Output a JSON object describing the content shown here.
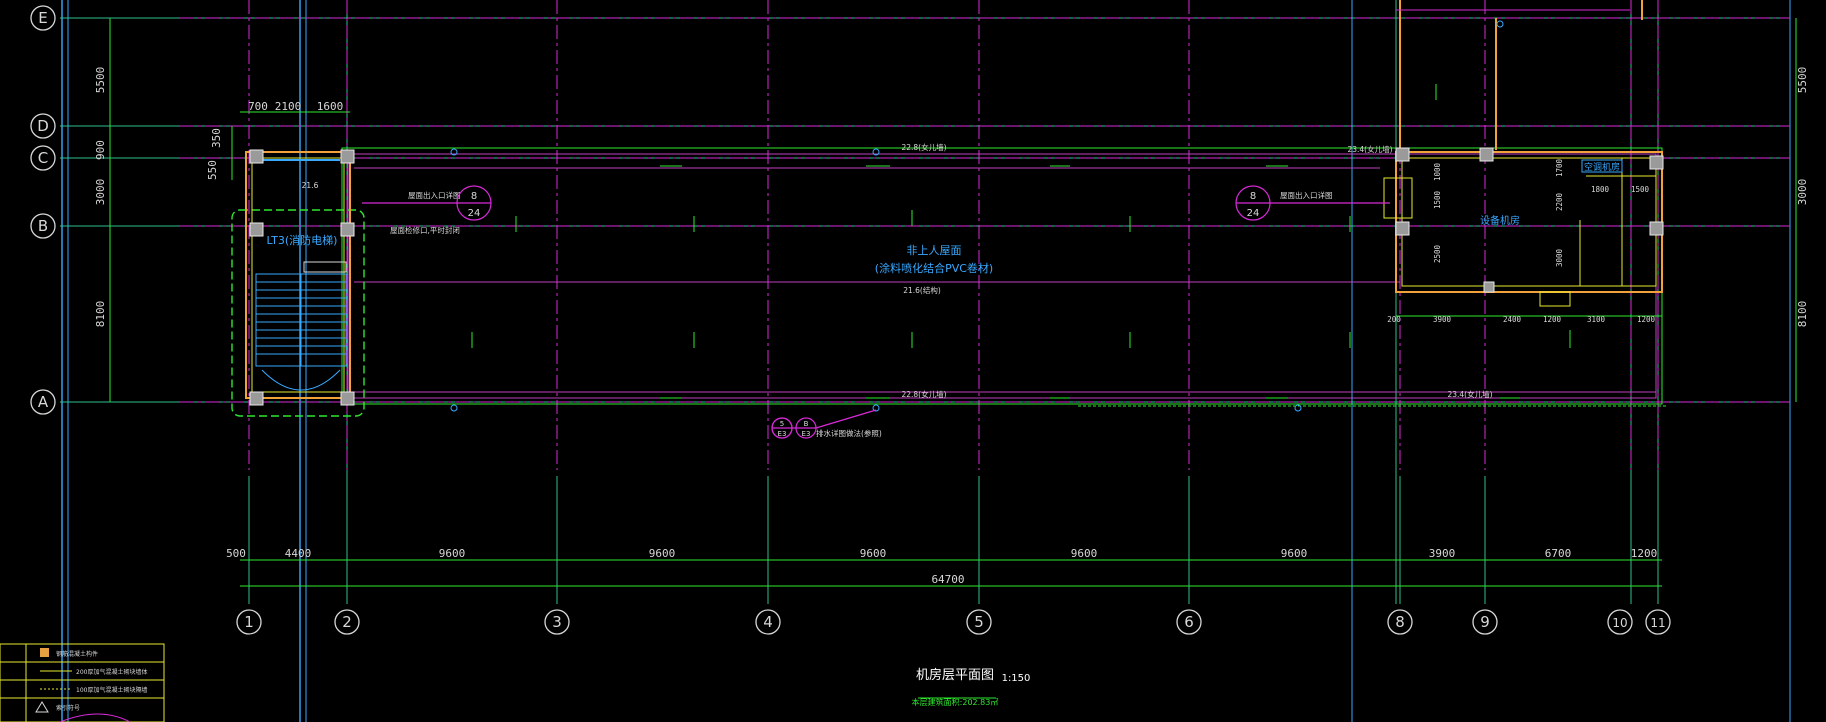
{
  "colors": {
    "background": "#000000",
    "axis_line": "#2fbf8a",
    "grid_dash": "#d82ad8",
    "wall": "#f2a23a",
    "dim": "#2ee82e",
    "text_white": "#ffffff",
    "text_cyan": "#39a8ff",
    "bubble": "#d8d8d8",
    "legend_yellow": "#e8e830",
    "purple_detail": "#c040c0"
  },
  "drawing": {
    "title": "机房层平面图",
    "scale": "1:150",
    "area_note": "本层建筑面积:202.83㎡"
  },
  "row_axes": [
    {
      "label": "E"
    },
    {
      "label": "D"
    },
    {
      "label": "C"
    },
    {
      "label": "B"
    },
    {
      "label": "A"
    }
  ],
  "col_axes": [
    {
      "label": "1"
    },
    {
      "label": "2"
    },
    {
      "label": "3"
    },
    {
      "label": "4"
    },
    {
      "label": "5"
    },
    {
      "label": "6"
    },
    {
      "label": "8"
    },
    {
      "label": "9"
    },
    {
      "label": "10"
    },
    {
      "label": "11"
    }
  ],
  "dims_left": [
    {
      "value": "5500"
    },
    {
      "value": "900"
    },
    {
      "value": "3000"
    },
    {
      "value": "8100"
    }
  ],
  "dims_left_inner": [
    {
      "value": "350"
    },
    {
      "value": "550"
    }
  ],
  "dims_right": [
    {
      "value": "5500"
    },
    {
      "value": "3000"
    },
    {
      "value": "8100"
    }
  ],
  "dims_top": [
    {
      "value": "700"
    },
    {
      "value": "2100"
    },
    {
      "value": "1600"
    }
  ],
  "dims_bottom": [
    {
      "value": "500"
    },
    {
      "value": "4400"
    },
    {
      "value": "9600"
    },
    {
      "value": "9600"
    },
    {
      "value": "9600"
    },
    {
      "value": "9600"
    },
    {
      "value": "9600"
    },
    {
      "value": "3900"
    },
    {
      "value": "6700"
    },
    {
      "value": "1200"
    }
  ],
  "dim_total": "64700",
  "labels": {
    "elevator": "LT3(消防电梯)",
    "roof_main": "非上人屋面",
    "roof_sub": "(涂料喷化结合PVC卷材)",
    "equip_room": "设备机房",
    "room2": "空调机房",
    "elev_mid": "21.6(结构)",
    "elev_top1": "22.8(女儿墙)",
    "elev_top2": "23.4(女儿墙)",
    "elev_bot1": "22.8(女儿墙)",
    "elev_bot2": "23.4(女儿墙)",
    "elev_stair": "21.6",
    "note_left1": "屋面检修口,平时封闭",
    "note_left2": "屋面出入口详图",
    "note_right": "屋面出入口详图",
    "tag_left_top": "8",
    "tag_left_bot": "24",
    "tag_right_top": "8",
    "tag_right_bot": "24",
    "sheet_ref1": "5",
    "sheet_ref2": "E3",
    "sheet_ref3": "B",
    "sheet_ref4": "E3",
    "detail_note": "排水详图做法(参照)",
    "eq_d1": "3900",
    "eq_d2": "2400",
    "eq_d3": "3100",
    "eq_d4": "1200",
    "eq_d5": "200",
    "eq_d6": "1200",
    "room_d1": "1800",
    "room_d2": "1500",
    "room_v1": "1500",
    "room_v2": "2500",
    "room_v3": "3000",
    "room_v4": "2200",
    "room_v5": "1000",
    "room_v6": "1700"
  },
  "legend": {
    "item1": "钢筋混凝土构件",
    "item2": "200厚加气混凝土砌块墙体",
    "item3": "100厚加气混凝土砌块隔墙",
    "item4": "索引符号"
  }
}
